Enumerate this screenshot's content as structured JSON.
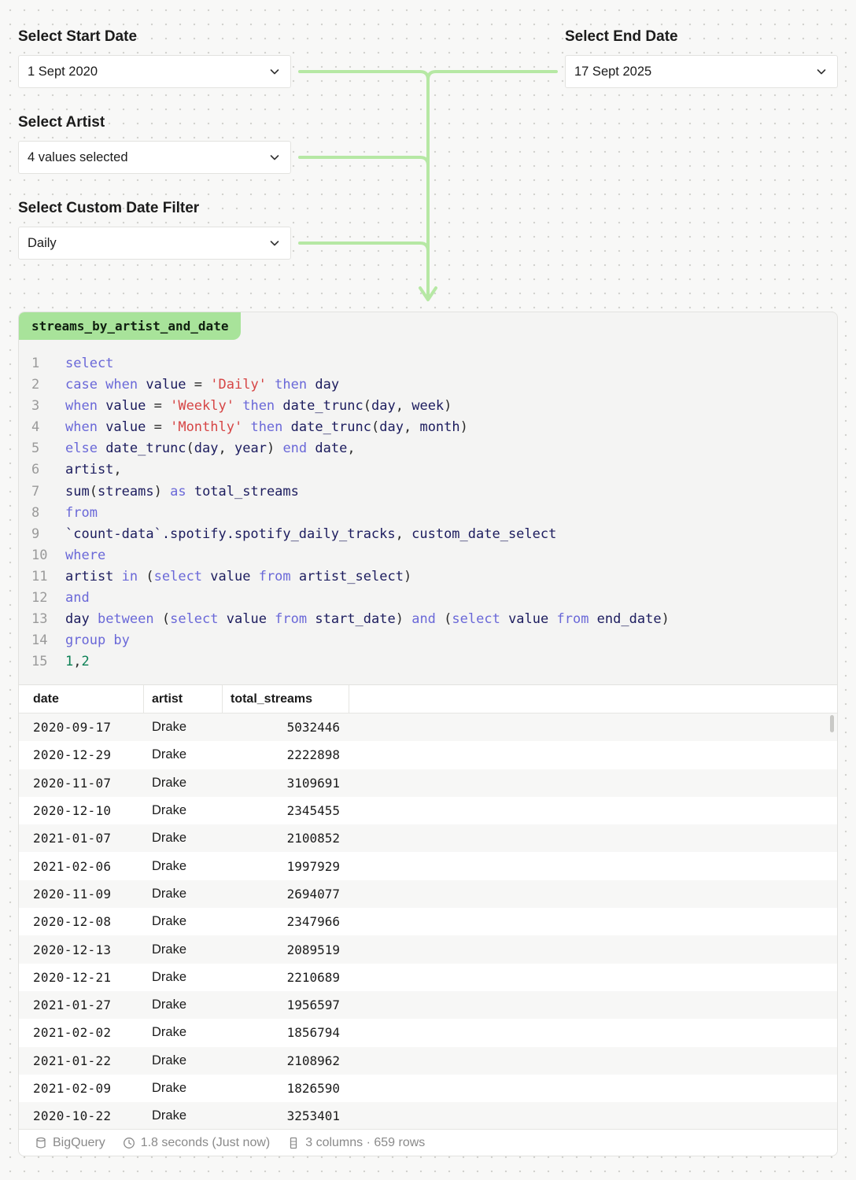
{
  "filters": {
    "start_date": {
      "label": "Select Start Date",
      "value": "1 Sept 2020"
    },
    "end_date": {
      "label": "Select End Date",
      "value": "17 Sept 2025"
    },
    "artist": {
      "label": "Select Artist",
      "value": "4 values selected"
    },
    "custom_date": {
      "label": "Select Custom Date Filter",
      "value": "Daily"
    }
  },
  "query": {
    "name": "streams_by_artist_and_date",
    "line_numbers": [
      "1",
      "2",
      "3",
      "4",
      "5",
      "6",
      "7",
      "8",
      "9",
      "10",
      "11",
      "12",
      "13",
      "14",
      "15"
    ],
    "lines": [
      [
        [
          "kw",
          "select"
        ]
      ],
      [
        [
          "kw",
          "case when "
        ],
        [
          "id",
          "value"
        ],
        [
          "pn",
          " = "
        ],
        [
          "str",
          "'Daily'"
        ],
        [
          "kw",
          " then "
        ],
        [
          "id",
          "day"
        ]
      ],
      [
        [
          "kw",
          "when "
        ],
        [
          "id",
          "value"
        ],
        [
          "pn",
          " = "
        ],
        [
          "str",
          "'Weekly'"
        ],
        [
          "kw",
          " then "
        ],
        [
          "id",
          "date_trunc"
        ],
        [
          "pn",
          "("
        ],
        [
          "id",
          "day"
        ],
        [
          "pn",
          ", "
        ],
        [
          "id",
          "week"
        ],
        [
          "pn",
          ")"
        ]
      ],
      [
        [
          "kw",
          "when "
        ],
        [
          "id",
          "value"
        ],
        [
          "pn",
          " = "
        ],
        [
          "str",
          "'Monthly'"
        ],
        [
          "kw",
          " then "
        ],
        [
          "id",
          "date_trunc"
        ],
        [
          "pn",
          "("
        ],
        [
          "id",
          "day"
        ],
        [
          "pn",
          ", "
        ],
        [
          "id",
          "month"
        ],
        [
          "pn",
          ")"
        ]
      ],
      [
        [
          "kw",
          "else "
        ],
        [
          "id",
          "date_trunc"
        ],
        [
          "pn",
          "("
        ],
        [
          "id",
          "day"
        ],
        [
          "pn",
          ", "
        ],
        [
          "id",
          "year"
        ],
        [
          "pn",
          ")"
        ],
        [
          "kw",
          " end "
        ],
        [
          "id",
          "date"
        ],
        [
          "pn",
          ","
        ]
      ],
      [
        [
          "id",
          "artist"
        ],
        [
          "pn",
          ","
        ]
      ],
      [
        [
          "id",
          "sum"
        ],
        [
          "pn",
          "("
        ],
        [
          "id",
          "streams"
        ],
        [
          "pn",
          ")"
        ],
        [
          "kw",
          " as "
        ],
        [
          "id",
          "total_streams"
        ]
      ],
      [
        [
          "kw",
          "from"
        ]
      ],
      [
        [
          "id",
          "`count-data`.spotify.spotify_daily_tracks"
        ],
        [
          "pn",
          ", "
        ],
        [
          "id",
          "custom_date_select"
        ]
      ],
      [
        [
          "kw",
          "where"
        ]
      ],
      [
        [
          "id",
          "artist"
        ],
        [
          "kw",
          " in "
        ],
        [
          "pn",
          "("
        ],
        [
          "kw",
          "select "
        ],
        [
          "id",
          "value"
        ],
        [
          "kw",
          " from "
        ],
        [
          "id",
          "artist_select"
        ],
        [
          "pn",
          ")"
        ]
      ],
      [
        [
          "kw",
          "and"
        ]
      ],
      [
        [
          "id",
          "day"
        ],
        [
          "kw",
          " between "
        ],
        [
          "pn",
          "("
        ],
        [
          "kw",
          "select "
        ],
        [
          "id",
          "value"
        ],
        [
          "kw",
          " from "
        ],
        [
          "id",
          "start_date"
        ],
        [
          "pn",
          ") "
        ],
        [
          "kw",
          "and "
        ],
        [
          "pn",
          "("
        ],
        [
          "kw",
          "select "
        ],
        [
          "id",
          "value"
        ],
        [
          "kw",
          " from "
        ],
        [
          "id",
          "end_date"
        ],
        [
          "pn",
          ")"
        ]
      ],
      [
        [
          "kw",
          "group by"
        ]
      ],
      [
        [
          "num",
          "1"
        ],
        [
          "pn",
          ","
        ],
        [
          "num",
          "2"
        ]
      ]
    ]
  },
  "results": {
    "columns": [
      "date",
      "artist",
      "total_streams"
    ],
    "rows": [
      [
        "2020-09-17",
        "Drake",
        "5032446"
      ],
      [
        "2020-12-29",
        "Drake",
        "2222898"
      ],
      [
        "2020-11-07",
        "Drake",
        "3109691"
      ],
      [
        "2020-12-10",
        "Drake",
        "2345455"
      ],
      [
        "2021-01-07",
        "Drake",
        "2100852"
      ],
      [
        "2021-02-06",
        "Drake",
        "1997929"
      ],
      [
        "2020-11-09",
        "Drake",
        "2694077"
      ],
      [
        "2020-12-08",
        "Drake",
        "2347966"
      ],
      [
        "2020-12-13",
        "Drake",
        "2089519"
      ],
      [
        "2020-12-21",
        "Drake",
        "2210689"
      ],
      [
        "2021-01-27",
        "Drake",
        "1956597"
      ],
      [
        "2021-02-02",
        "Drake",
        "1856794"
      ],
      [
        "2021-01-22",
        "Drake",
        "2108962"
      ],
      [
        "2021-02-09",
        "Drake",
        "1826590"
      ],
      [
        "2020-10-22",
        "Drake",
        "3253401"
      ],
      [
        "",
        "",
        ""
      ]
    ]
  },
  "footer": {
    "source": "BigQuery",
    "duration": "1.8 seconds (Just now)",
    "summary": "3 columns · 659 rows"
  },
  "colors": {
    "accent_green": "#a8e39a",
    "connector_green": "#b6e8a4",
    "keyword": "#6a68d8",
    "identifier": "#1c1c5e",
    "string": "#d64545",
    "number": "#0b8055"
  }
}
